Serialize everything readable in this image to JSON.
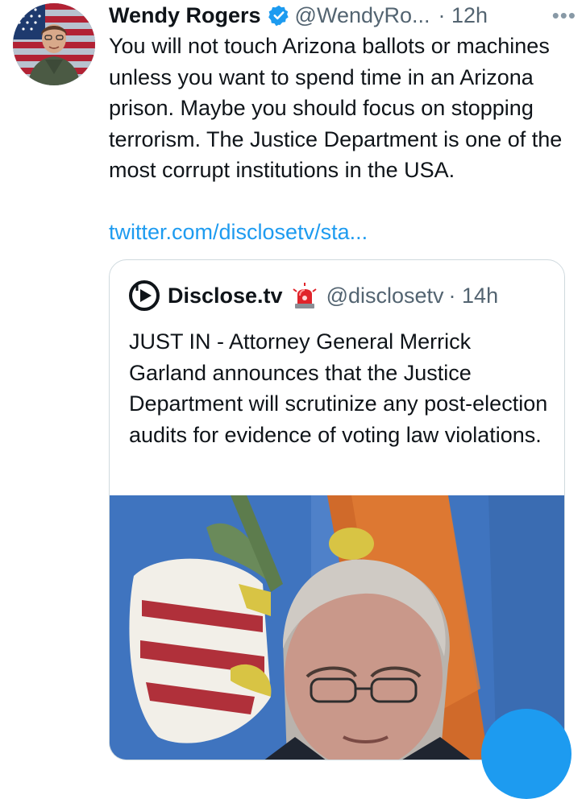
{
  "tweet": {
    "author_name": "Wendy Rogers",
    "handle": "@WendyRo...",
    "time": "· 12h",
    "more": "•••",
    "text": "You will not touch Arizona ballots or machines unless you want to spend time in an Arizona prison. Maybe you should focus on stopping terrorism. The Justice Department is one of the most corrupt institutions in the USA.",
    "link": "twitter.com/disclosetv/sta..."
  },
  "quote": {
    "author_name": "Disclose.tv",
    "handle": "@disclosetv",
    "time": "· 14h",
    "text": "JUST IN - Attorney General Merrick Garland announces that the Justice Department will scrutinize any post-election audits for evidence of voting law violations."
  },
  "icons": {
    "verified": "verified-badge-icon",
    "more": "more-options-icon",
    "quote_logo": "disclose-logo-icon",
    "siren": "siren-emoji-icon"
  },
  "colors": {
    "link": "#1d9bf0",
    "secondary_text": "#536471",
    "verified": "#1d9bf0"
  }
}
